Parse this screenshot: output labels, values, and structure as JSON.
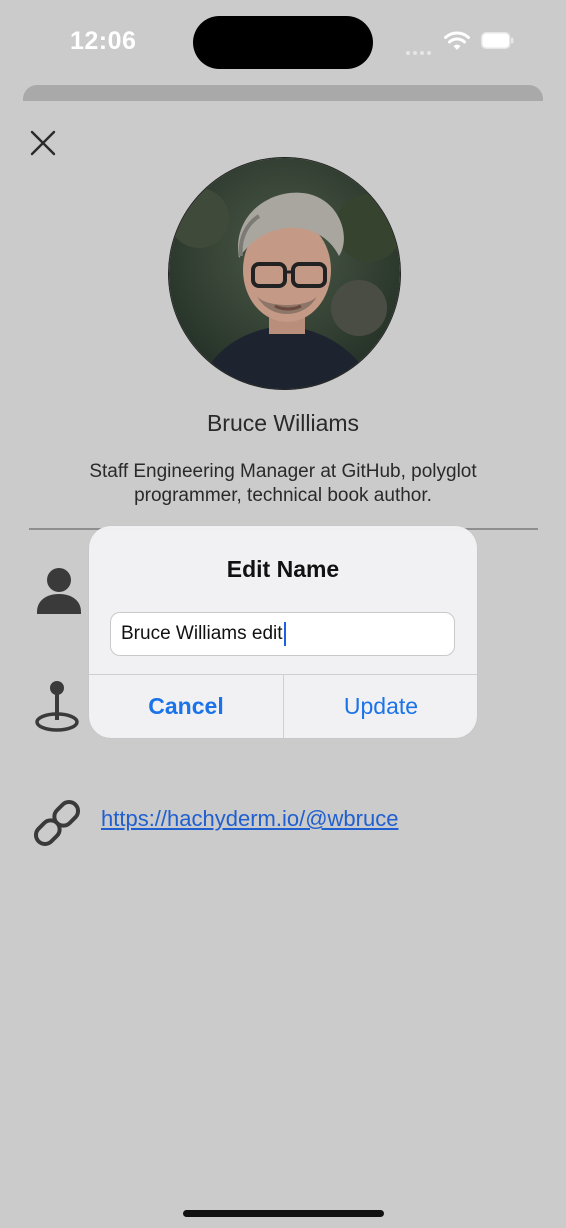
{
  "status_bar": {
    "time": "12:06"
  },
  "profile": {
    "name": "Bruce Williams",
    "bio": "Staff Engineering Manager at GitHub, polyglot programmer, technical book author.",
    "link": "https://hachyderm.io/@wbruce"
  },
  "alert": {
    "title": "Edit Name",
    "field_value": "Bruce Williams edit",
    "cancel_label": "Cancel",
    "update_label": "Update"
  },
  "icons": {
    "close": "close-icon",
    "person": "person-icon",
    "location": "location-pin-icon",
    "link": "link-icon"
  },
  "colors": {
    "background": "#cbcbcb",
    "accent": "#1a73e8",
    "link": "#1f5fd0"
  }
}
